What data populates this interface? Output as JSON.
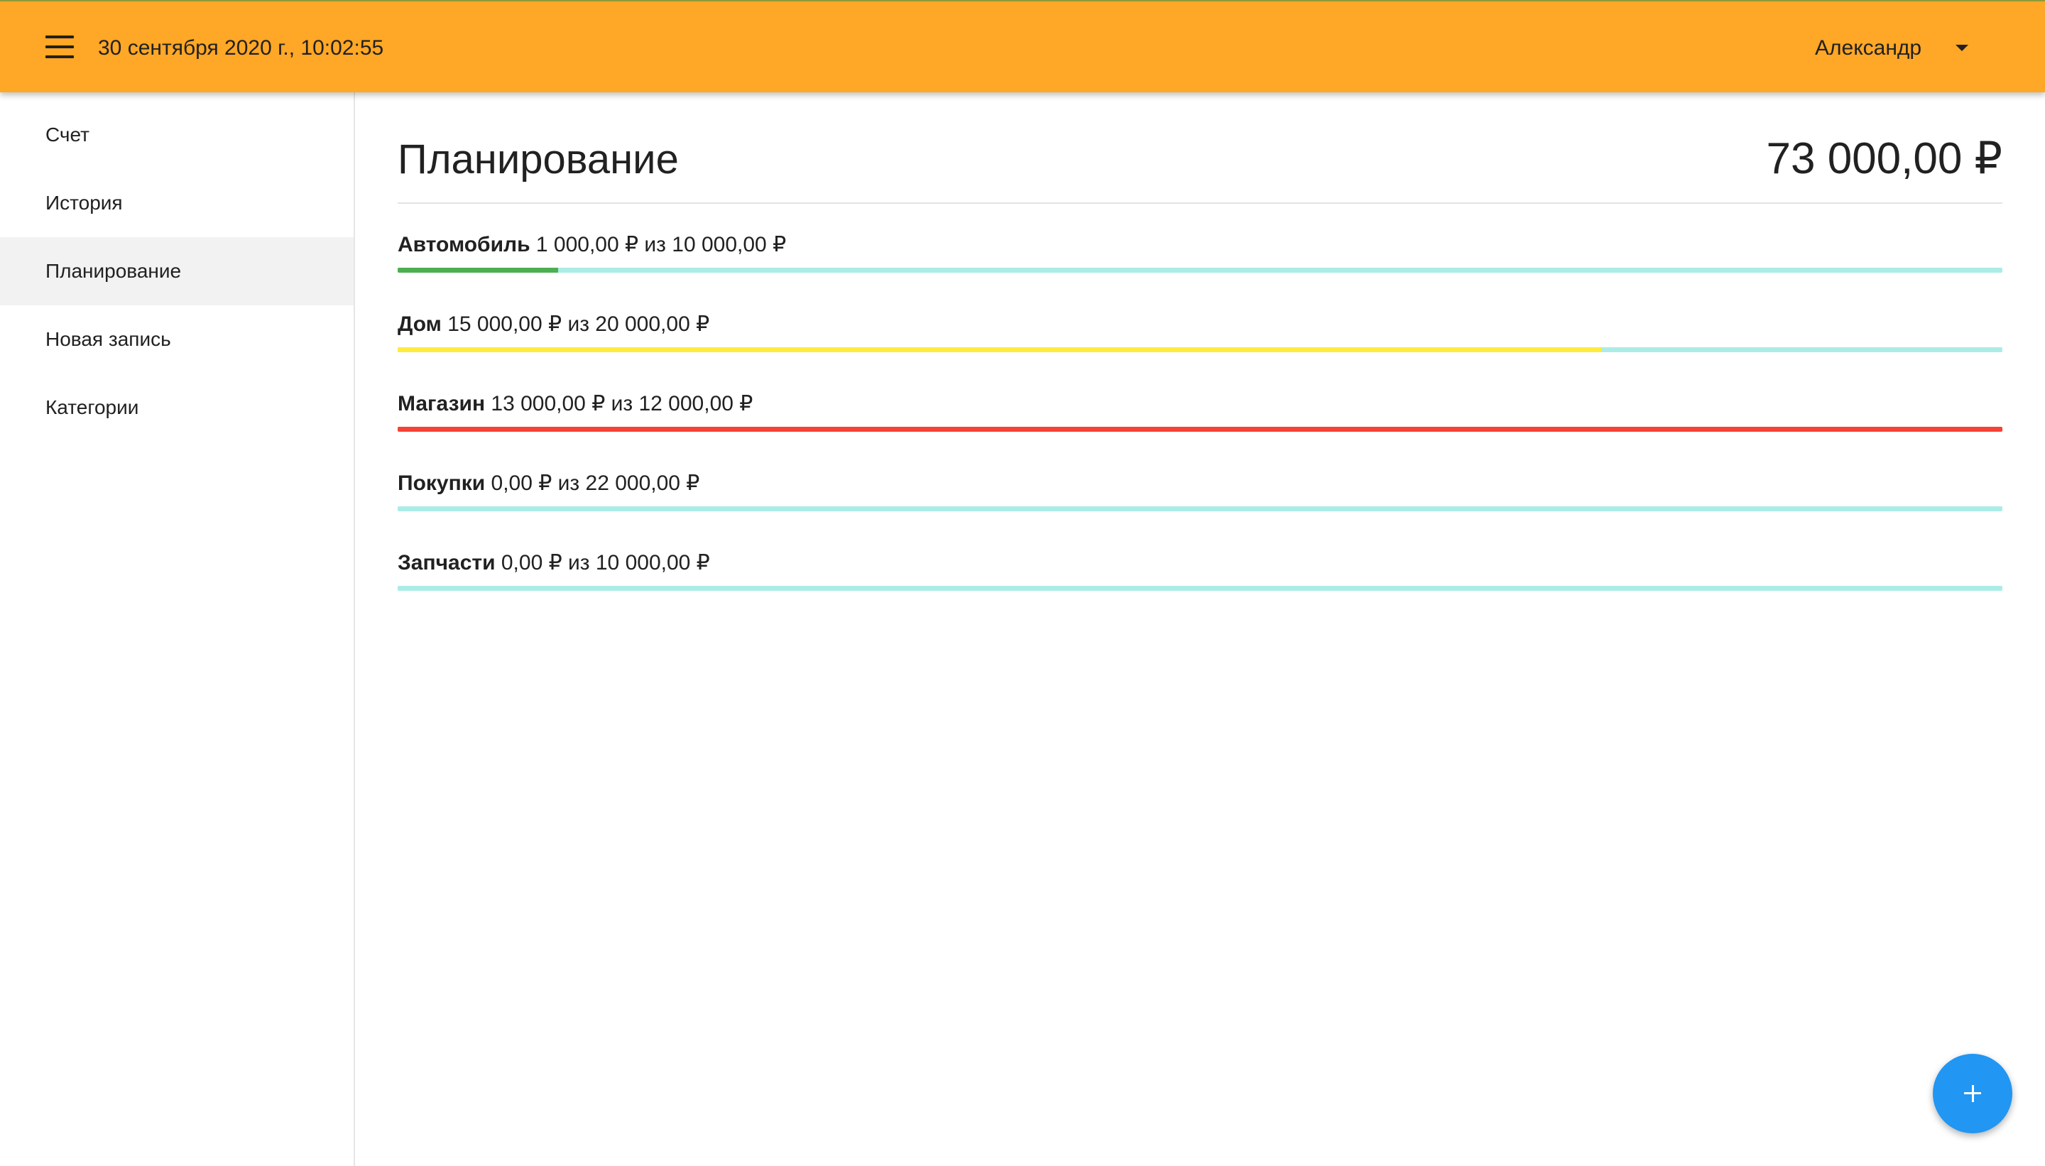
{
  "header": {
    "datetime": "30 сентября 2020 г., 10:02:55",
    "user_name": "Александр"
  },
  "sidebar": {
    "items": [
      {
        "label": "Счет",
        "active": false
      },
      {
        "label": "История",
        "active": false
      },
      {
        "label": "Планирование",
        "active": true
      },
      {
        "label": "Новая запись",
        "active": false
      },
      {
        "label": "Категории",
        "active": false
      }
    ]
  },
  "main": {
    "title": "Планирование",
    "total": "73 000,00 ₽",
    "plans": [
      {
        "name": "Автомобиль",
        "amount": "1 000,00 ₽ из 10 000,00 ₽",
        "progress": 0.1,
        "color": "#4caf50"
      },
      {
        "name": "Дом",
        "amount": "15 000,00 ₽ из 20 000,00 ₽",
        "progress": 0.75,
        "color": "#ffeb3b"
      },
      {
        "name": "Магазин",
        "amount": "13 000,00 ₽ из 12 000,00 ₽",
        "progress": 1.0,
        "color": "#f44336"
      },
      {
        "name": "Покупки",
        "amount": "0,00 ₽ из 22 000,00 ₽",
        "progress": 0.0,
        "color": "#4caf50"
      },
      {
        "name": "Запчасти",
        "amount": "0,00 ₽ из 10 000,00 ₽",
        "progress": 0.0,
        "color": "#4caf50"
      }
    ]
  },
  "colors": {
    "topbar": "#ffa726",
    "track": "#acece6",
    "fab": "#2196f3"
  },
  "icons": {
    "menu": "menu-icon",
    "user_dropdown": "caret-down-icon",
    "fab": "plus-icon"
  }
}
